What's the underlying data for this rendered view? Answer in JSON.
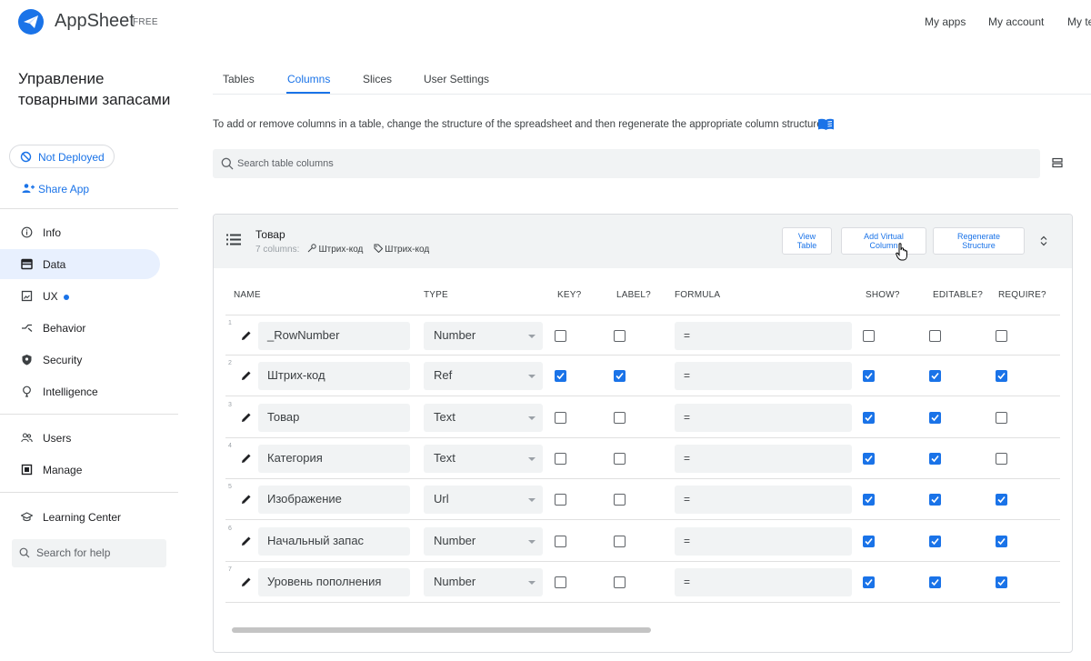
{
  "brand": {
    "name": "AppSheet",
    "plan": "FREE"
  },
  "top_nav": [
    "My apps",
    "My account",
    "My te"
  ],
  "app": {
    "title": "Управление товарными запасами",
    "deploy_status": "Not Deployed",
    "share": "Share App"
  },
  "sidebar": {
    "items": [
      {
        "label": "Info",
        "icon": "info-icon"
      },
      {
        "label": "Data",
        "icon": "table-icon",
        "active": true
      },
      {
        "label": "UX",
        "icon": "ux-icon",
        "dot": true
      },
      {
        "label": "Behavior",
        "icon": "behavior-icon"
      },
      {
        "label": "Security",
        "icon": "shield-icon"
      },
      {
        "label": "Intelligence",
        "icon": "bulb-icon"
      },
      {
        "label": "Users",
        "icon": "users-icon"
      },
      {
        "label": "Manage",
        "icon": "manage-icon"
      },
      {
        "label": "Learning Center",
        "icon": "graduation-cap-icon"
      }
    ],
    "help_placeholder": "Search for help"
  },
  "tabs": [
    {
      "label": "Tables"
    },
    {
      "label": "Columns",
      "active": true
    },
    {
      "label": "Slices"
    },
    {
      "label": "User Settings"
    }
  ],
  "description": "To add or remove columns in a table, change the structure of the spreadsheet and then regenerate the appropriate column structure",
  "search_placeholder": "Search table columns",
  "table": {
    "name": "Товар",
    "columns_count": "7 columns:",
    "key_label": "Штрих-код",
    "label_label": "Штрих-код",
    "buttons": {
      "view_line1": "View",
      "view_line2": "Table",
      "add_line1": "Add Virtual",
      "add_line2": "Column",
      "regen_line1": "Regenerate",
      "regen_line2": "Structure"
    },
    "headers": {
      "name": "NAME",
      "type": "TYPE",
      "key": "KEY?",
      "label": "LABEL?",
      "formula": "FORMULA",
      "show": "SHOW?",
      "editable": "EDITABLE?",
      "require": "REQUIRE?"
    },
    "rows": [
      {
        "idx": "1",
        "name": "_RowNumber",
        "type": "Number",
        "key": false,
        "label": false,
        "formula": "=",
        "show": false,
        "editable": false,
        "require": false
      },
      {
        "idx": "2",
        "name": "Штрих-код",
        "type": "Ref",
        "key": true,
        "label": true,
        "formula": "=",
        "show": true,
        "editable": true,
        "require": true
      },
      {
        "idx": "3",
        "name": "Товар",
        "type": "Text",
        "key": false,
        "label": false,
        "formula": "=",
        "show": true,
        "editable": true,
        "require": false
      },
      {
        "idx": "4",
        "name": "Категория",
        "type": "Text",
        "key": false,
        "label": false,
        "formula": "=",
        "show": true,
        "editable": true,
        "require": false
      },
      {
        "idx": "5",
        "name": "Изображение",
        "type": "Url",
        "key": false,
        "label": false,
        "formula": "=",
        "show": true,
        "editable": true,
        "require": true
      },
      {
        "idx": "6",
        "name": "Начальный запас",
        "type": "Number",
        "key": false,
        "label": false,
        "formula": "=",
        "show": true,
        "editable": true,
        "require": true
      },
      {
        "idx": "7",
        "name": "Уровень пополнения",
        "type": "Number",
        "key": false,
        "label": false,
        "formula": "=",
        "show": true,
        "editable": true,
        "require": true
      }
    ]
  },
  "colors": {
    "accent": "#1a73e8",
    "active_bg": "#e8f0fe",
    "field_bg": "#f1f3f4"
  }
}
